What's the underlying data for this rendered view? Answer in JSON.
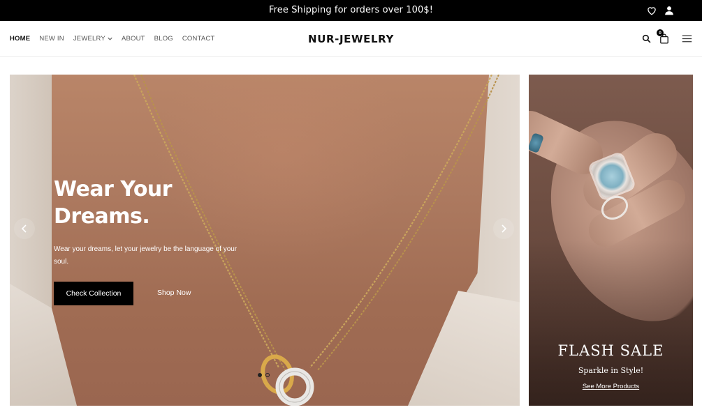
{
  "topbar": {
    "message": "Free Shipping for orders over 100$!",
    "icons": [
      "heart-icon",
      "user-icon"
    ]
  },
  "header": {
    "logo": "NUR-JEWELRY",
    "nav": [
      {
        "label": "HOME",
        "active": true
      },
      {
        "label": "NEW IN",
        "active": false
      },
      {
        "label": "JEWELRY",
        "active": false,
        "has_dropdown": true
      },
      {
        "label": "ABOUT",
        "active": false
      },
      {
        "label": "BLOG",
        "active": false
      },
      {
        "label": "CONTACT",
        "active": false
      }
    ],
    "icons": [
      "search-icon",
      "bag-icon",
      "menu-icon"
    ],
    "cart_count": "0"
  },
  "hero": {
    "title_line1": "Wear Your",
    "title_line2": "Dreams.",
    "subtitle": "Wear your dreams, let your jewelry be the language of your soul.",
    "primary_button": "Check Collection",
    "secondary_link": "Shop Now",
    "slides_total": 2,
    "active_slide": 1
  },
  "promo": {
    "title": "FLASH SALE",
    "subtitle": "Sparkle in Style!",
    "link": "See More Products"
  },
  "colors": {
    "topbar_bg": "#000000",
    "button_bg": "#000000",
    "text_light": "#ffffff"
  }
}
